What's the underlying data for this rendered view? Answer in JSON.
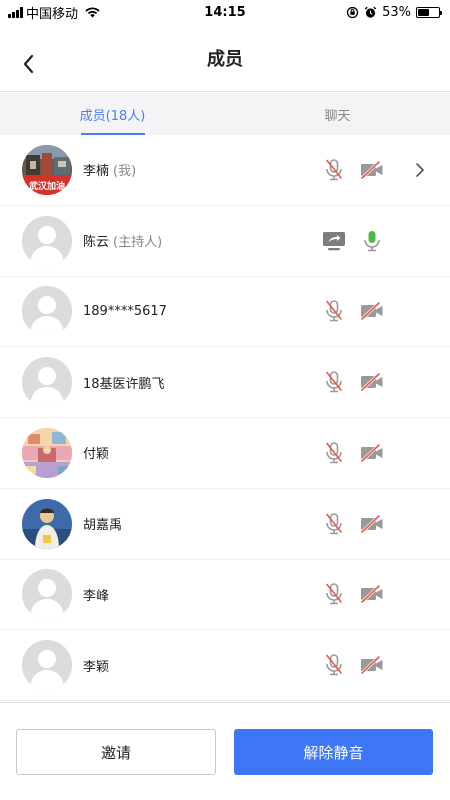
{
  "status_bar": {
    "carrier": "中国移动",
    "time": "14:15",
    "battery": "53%",
    "battery_level": 0.53
  },
  "nav": {
    "title": "成员",
    "back_icon": "chevron-left-icon"
  },
  "tabs": [
    {
      "label": "成员(18人)",
      "active": true
    },
    {
      "label": "聊天",
      "active": false
    }
  ],
  "members": [
    {
      "name": "李楠",
      "tag": "(我)",
      "avatar": "photo",
      "mic": "muted",
      "camera": "off",
      "has_chevron": true
    },
    {
      "name": "陈云",
      "tag": "(主持人)",
      "avatar": "default",
      "mic": "on",
      "screen_share": true
    },
    {
      "name": "189****5617",
      "tag": "",
      "avatar": "default",
      "mic": "muted",
      "camera": "off"
    },
    {
      "name": "18基医许鹏飞",
      "tag": "",
      "avatar": "default",
      "mic": "muted",
      "camera": "off"
    },
    {
      "name": "付颖",
      "tag": "",
      "avatar": "photo",
      "mic": "muted",
      "camera": "off"
    },
    {
      "name": "胡嘉禹",
      "tag": "",
      "avatar": "photo",
      "mic": "muted",
      "camera": "off"
    },
    {
      "name": "李峰",
      "tag": "",
      "avatar": "default",
      "mic": "muted",
      "camera": "off"
    },
    {
      "name": "李颖",
      "tag": "",
      "avatar": "default",
      "mic": "muted",
      "camera": "off"
    }
  ],
  "actions": {
    "invite": "邀请",
    "unmute": "解除静音"
  },
  "colors": {
    "accent": "#4a7ef5",
    "primary_button": "#3d77f5",
    "mic_on": "#4cbb45",
    "muted_slash": "#e8574a"
  }
}
